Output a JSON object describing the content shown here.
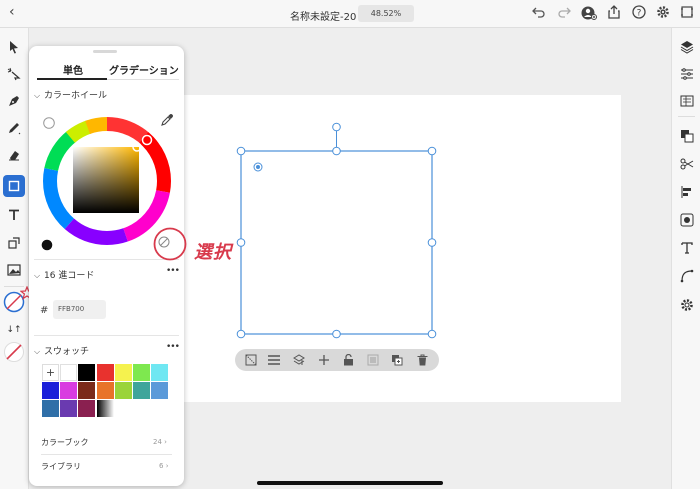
{
  "header": {
    "back_icon": "chevron-left-icon",
    "doc_title": "名称未設定-20",
    "zoom": "48.52%",
    "icons": [
      "undo-icon",
      "redo-icon",
      "add-user-icon",
      "share-icon",
      "help-icon",
      "settings-icon",
      "shortcut-icon"
    ]
  },
  "left_toolbar": {
    "tools": [
      "select-tool",
      "direct-select-tool",
      "pen-tool",
      "pencil-tool",
      "eraser-tool",
      "rectangle-tool",
      "type-tool",
      "transform-tool",
      "image-tool"
    ]
  },
  "right_toolbar": {
    "tools": [
      "layers-icon",
      "properties-icon",
      "libraries-icon",
      "pathfinder-icon",
      "cut-icon",
      "align-icon",
      "symbol-icon",
      "type-icon",
      "curve-icon",
      "settings-gear-icon"
    ]
  },
  "color_panel": {
    "tabs": [
      "単色",
      "グラデーション"
    ],
    "wheel_section": "カラーホイール",
    "hex_section": "16 進コード",
    "hex_value": "FFB700",
    "swatch_section": "スウォッチ",
    "swatch_add": "+",
    "swatch_colors": [
      "#ffffff",
      "#000000",
      "#e8322e",
      "#f5f24e",
      "#7ee84f",
      "#6fe7f2",
      "#1a1fd9",
      "#d93be0",
      "#7b2a1a",
      "#e8732a",
      "#9ad43a",
      "#3fa59b",
      "#5b9ad9",
      "#2f6fa8",
      "#6a3ab0",
      "#8a2050",
      "gradient"
    ],
    "colorbook_label": "カラーブック",
    "colorbook_count": "24",
    "library_label": "ライブラリ",
    "library_count": "6",
    "fill_color": "#ffb700"
  },
  "annotation": {
    "text": "選択",
    "color": "#d83a4c"
  },
  "selection_color": "#4a90d9",
  "context_bar": {
    "icons": [
      "mask-icon",
      "align-menu-icon",
      "arrange-icon",
      "add-point-icon",
      "lock-icon",
      "flatten-icon",
      "duplicate-icon",
      "trash-icon"
    ]
  }
}
